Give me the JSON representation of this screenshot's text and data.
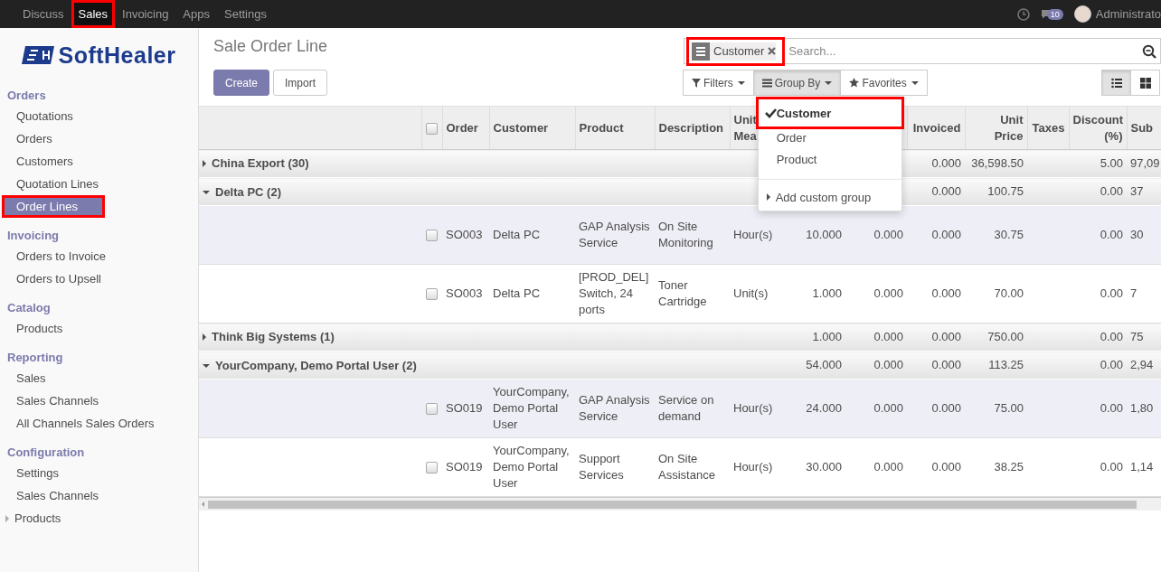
{
  "top_menu": [
    {
      "label": "Discuss",
      "selected": false,
      "highlighted": false
    },
    {
      "label": "Sales",
      "selected": true,
      "highlighted": true
    },
    {
      "label": "Invoicing",
      "selected": false,
      "highlighted": false
    },
    {
      "label": "Apps",
      "selected": false,
      "highlighted": false
    },
    {
      "label": "Settings",
      "selected": false,
      "highlighted": false
    }
  ],
  "systray": {
    "message_count": "10",
    "user": "Administrato"
  },
  "logo": {
    "text": "SoftHealer"
  },
  "sidebar": {
    "sections": [
      {
        "title": "Orders",
        "items": [
          {
            "label": "Quotations",
            "selected": false,
            "highlighted": false
          },
          {
            "label": "Orders",
            "selected": false,
            "highlighted": false
          },
          {
            "label": "Customers",
            "selected": false,
            "highlighted": false
          },
          {
            "label": "Quotation Lines",
            "selected": false,
            "highlighted": false
          },
          {
            "label": "Order Lines",
            "selected": true,
            "highlighted": true
          }
        ]
      },
      {
        "title": "Invoicing",
        "items": [
          {
            "label": "Orders to Invoice",
            "selected": false,
            "highlighted": false
          },
          {
            "label": "Orders to Upsell",
            "selected": false,
            "highlighted": false
          }
        ]
      },
      {
        "title": "Catalog",
        "items": [
          {
            "label": "Products",
            "selected": false,
            "highlighted": false
          }
        ]
      },
      {
        "title": "Reporting",
        "items": [
          {
            "label": "Sales",
            "selected": false,
            "highlighted": false
          },
          {
            "label": "Sales Channels",
            "selected": false,
            "highlighted": false
          },
          {
            "label": "All Channels Sales Orders",
            "selected": false,
            "highlighted": false
          }
        ]
      },
      {
        "title": "Configuration",
        "items": [
          {
            "label": "Settings",
            "selected": false,
            "highlighted": false
          },
          {
            "label": "Sales Channels",
            "selected": false,
            "highlighted": false
          },
          {
            "label": "Products",
            "selected": false,
            "highlighted": false,
            "expanded": false
          }
        ]
      }
    ]
  },
  "breadcrumb": "Sale Order Line",
  "buttons": [
    {
      "label": "Create",
      "kind": "primary"
    },
    {
      "label": "Import",
      "kind": "secondary"
    }
  ],
  "search": {
    "facets": [
      {
        "label": "Customer",
        "highlighted": true
      }
    ],
    "placeholder": "Search..."
  },
  "search_buttons": [
    {
      "label": "Filters",
      "kind": "filter",
      "selected": false
    },
    {
      "label": "Group By",
      "kind": "group",
      "selected": true
    },
    {
      "label": "Favorites",
      "kind": "favorite",
      "selected": false
    }
  ],
  "view_switcher": [
    {
      "kind": "list",
      "selected": true
    },
    {
      "kind": "kanban",
      "selected": false
    }
  ],
  "group_by_menu": {
    "items": [
      {
        "label": "Customer",
        "checked": true,
        "highlighted": true
      },
      {
        "label": "Order",
        "checked": false,
        "highlighted": false
      },
      {
        "label": "Product",
        "checked": false,
        "highlighted": false
      }
    ],
    "custom": "Add custom group"
  },
  "table": {
    "header_checkbox": {
      "checked": false
    },
    "columns": {
      "order": {
        "label": "Order",
        "kind": "text"
      },
      "customer": {
        "label": "Customer",
        "kind": "text"
      },
      "product": {
        "label": "Product",
        "kind": "text"
      },
      "description": {
        "label": "Description",
        "kind": "text"
      },
      "unit": {
        "label": "Unit Mea",
        "kind": "text"
      },
      "column_8": {
        "kind": "number"
      },
      "column_9": {
        "kind": "number"
      },
      "invoiced": {
        "label": "Invoiced",
        "kind": "number"
      },
      "unit_price": {
        "label": "Unit Price",
        "kind": "number"
      },
      "taxes": {
        "label": "Taxes",
        "kind": "number"
      },
      "discount": {
        "label": "Discount (%)",
        "kind": "number"
      },
      "column_14": {
        "label": "Sub",
        "kind": "text"
      }
    },
    "groups": [
      {
        "label": "China Export (30)",
        "expanded": false,
        "totals": {
          "invoiced": "0.000",
          "unit_price": "36,598.50",
          "discount": "5.00",
          "column_14": "97,09"
        }
      },
      {
        "label": "Delta PC (2)",
        "expanded": true,
        "totals": {
          "invoiced": "0.000",
          "unit_price": "100.75",
          "discount": "0.00",
          "column_14": "37"
        },
        "rows": [
          {
            "checked": false,
            "cells": {
              "order": "SO003",
              "customer": "Delta PC",
              "product": "GAP Analysis Service",
              "description": "On Site Monitoring",
              "unit": "Hour(s)",
              "column_8": "10.000",
              "column_9": "0.000",
              "invoiced": "0.000",
              "unit_price": "30.75",
              "discount": "0.00",
              "column_14": "30"
            }
          },
          {
            "checked": false,
            "cells": {
              "order": "SO003",
              "customer": "Delta PC",
              "product": "[PROD_DEL] Switch, 24 ports",
              "description": "Toner Cartridge",
              "unit": "Unit(s)",
              "column_8": "1.000",
              "column_9": "0.000",
              "invoiced": "0.000",
              "unit_price": "70.00",
              "discount": "0.00",
              "column_14": "7"
            }
          }
        ]
      },
      {
        "label": "Think Big Systems (1)",
        "expanded": false,
        "totals": {
          "column_8": "1.000",
          "column_9": "0.000",
          "invoiced": "0.000",
          "unit_price": "750.00",
          "discount": "0.00",
          "column_14": "75"
        }
      },
      {
        "label": "YourCompany, Demo Portal User (2)",
        "expanded": true,
        "totals": {
          "column_8": "54.000",
          "column_9": "0.000",
          "invoiced": "0.000",
          "unit_price": "113.25",
          "discount": "0.00",
          "column_14": "2,94"
        },
        "rows": [
          {
            "checked": false,
            "cells": {
              "order": "SO019",
              "customer": "YourCompany, Demo Portal User",
              "product": "GAP Analysis Service",
              "description": "Service on demand",
              "unit": "Hour(s)",
              "column_8": "24.000",
              "column_9": "0.000",
              "invoiced": "0.000",
              "unit_price": "75.00",
              "discount": "0.00",
              "column_14": "1,80"
            }
          },
          {
            "checked": false,
            "cells": {
              "order": "SO019",
              "customer": "YourCompany, Demo Portal User",
              "product": "Support Services",
              "description": "On Site Assistance",
              "unit": "Hour(s)",
              "column_8": "30.000",
              "column_9": "0.000",
              "invoiced": "0.000",
              "unit_price": "38.25",
              "discount": "0.00",
              "column_14": "1,14"
            }
          }
        ]
      }
    ]
  }
}
